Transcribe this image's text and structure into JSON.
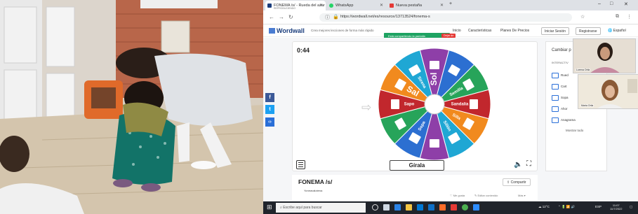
{
  "browser": {
    "tabs": [
      {
        "label": "FONEMA /s/ - Rueda del azar",
        "sublabel": "REPRODUCIENDO",
        "favicon_color": "#1a3d7c",
        "active": true
      },
      {
        "label": "WhatsApp",
        "favicon_color": "#25d366",
        "active": false
      },
      {
        "label": "Nueva pestaña",
        "favicon_color": "#e53935",
        "active": false
      }
    ],
    "url": "https://wordwall.net/es/resource/13713524/fonema-s"
  },
  "screen_share": {
    "sharing_text": "Está compartiendo la pantalla",
    "stop_label": "Dejar de"
  },
  "wordwall": {
    "logo": "Wordwall",
    "tagline": "Crea mejores lecciones de forma más rápido",
    "nav": [
      "Inicio",
      "Características",
      "Planes De Precios"
    ],
    "login": "Iniciar Sesión",
    "register": "Registrarse",
    "language": "Español"
  },
  "game": {
    "timer": "0:44",
    "spin_button": "Gírala",
    "wheel": {
      "segments": [
        {
          "label": "Sol",
          "color": "#8e3fa8"
        },
        {
          "label": "",
          "color": "#2c6fd1"
        },
        {
          "label": "Semilla",
          "color": "#27a45a"
        },
        {
          "label": "Sandalia",
          "color": "#c1272d"
        },
        {
          "label": "Silla",
          "color": "#f18a1e"
        },
        {
          "label": "Sillón",
          "color": "#1fa7d4"
        },
        {
          "label": "",
          "color": "#8e3fa8"
        },
        {
          "label": "Sopa",
          "color": "#2c6fd1"
        },
        {
          "label": "",
          "color": "#27a45a"
        },
        {
          "label": "Sapo",
          "color": "#c1272d"
        },
        {
          "label": "Sal",
          "color": "#f18a1e"
        },
        {
          "label": "Sirena",
          "color": "#1fa7d4"
        }
      ],
      "highlighted": "Sal"
    }
  },
  "activity": {
    "title": "FONEMA /s/",
    "author": "Yoneavalotena",
    "share_button": "Compartir",
    "like": "Me gusta",
    "edit": "Editar contenido",
    "more": "Más"
  },
  "panel": {
    "title": "Cambiar p",
    "subtitle": "INTERACTIV",
    "templates": [
      {
        "label": "Rued"
      },
      {
        "label": "Cart"
      },
      {
        "label": "Sopa"
      },
      {
        "label": "Ahor"
      },
      {
        "label": "Anagrama"
      }
    ],
    "show_all": "Mostrar todo"
  },
  "video_participants": [
    {
      "name": "Lorena Ortiz"
    },
    {
      "name": "María Ortiz"
    }
  ],
  "taskbar": {
    "search_placeholder": "Escribe aquí para buscar",
    "weather": "12°C",
    "lang": "ESP",
    "time": "11:07",
    "date": "11/7/2022"
  }
}
